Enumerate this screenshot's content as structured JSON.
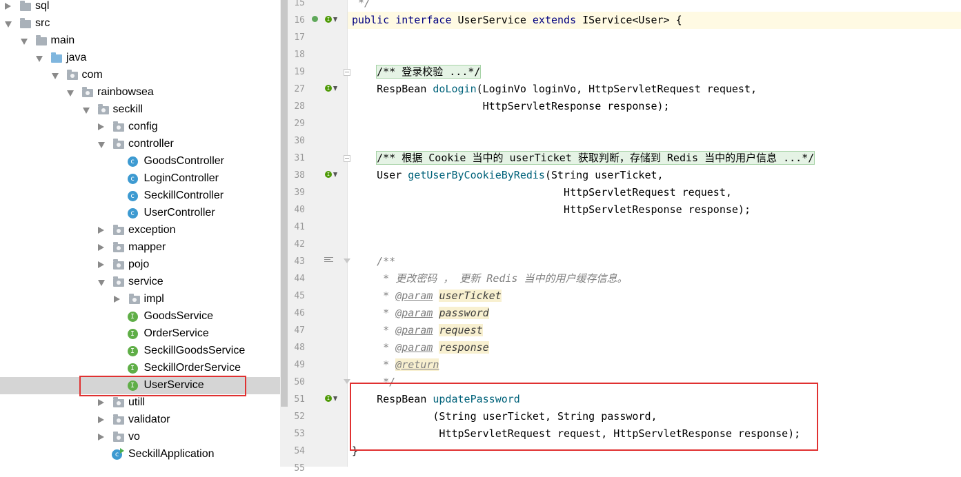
{
  "project_tree": {
    "items": [
      {
        "label": "sql",
        "depth": 0,
        "state": "collapsed",
        "icon": "folder-icon"
      },
      {
        "label": "src",
        "depth": 0,
        "state": "expanded",
        "icon": "folder-icon"
      },
      {
        "label": "main",
        "depth": 1,
        "state": "expanded",
        "icon": "folder-icon"
      },
      {
        "label": "java",
        "depth": 2,
        "state": "expanded",
        "icon": "source-folder-icon"
      },
      {
        "label": "com",
        "depth": 3,
        "state": "expanded",
        "icon": "package-icon"
      },
      {
        "label": "rainbowsea",
        "depth": 4,
        "state": "expanded",
        "icon": "package-icon"
      },
      {
        "label": "seckill",
        "depth": 5,
        "state": "expanded",
        "icon": "package-icon"
      },
      {
        "label": "config",
        "depth": 6,
        "state": "collapsed",
        "icon": "package-icon"
      },
      {
        "label": "controller",
        "depth": 6,
        "state": "expanded",
        "icon": "package-icon"
      },
      {
        "label": "GoodsController",
        "depth": 7,
        "state": "leaf",
        "icon": "class-icon"
      },
      {
        "label": "LoginController",
        "depth": 7,
        "state": "leaf",
        "icon": "class-icon"
      },
      {
        "label": "SeckillController",
        "depth": 7,
        "state": "leaf",
        "icon": "class-icon"
      },
      {
        "label": "UserController",
        "depth": 7,
        "state": "leaf",
        "icon": "class-icon"
      },
      {
        "label": "exception",
        "depth": 6,
        "state": "collapsed",
        "icon": "package-icon"
      },
      {
        "label": "mapper",
        "depth": 6,
        "state": "collapsed",
        "icon": "package-icon"
      },
      {
        "label": "pojo",
        "depth": 6,
        "state": "collapsed",
        "icon": "package-icon"
      },
      {
        "label": "service",
        "depth": 6,
        "state": "expanded",
        "icon": "package-icon"
      },
      {
        "label": "impl",
        "depth": 7,
        "state": "collapsed",
        "icon": "package-icon"
      },
      {
        "label": "GoodsService",
        "depth": 7,
        "state": "leaf",
        "icon": "interface-icon"
      },
      {
        "label": "OrderService",
        "depth": 7,
        "state": "leaf",
        "icon": "interface-icon"
      },
      {
        "label": "SeckillGoodsService",
        "depth": 7,
        "state": "leaf",
        "icon": "interface-icon"
      },
      {
        "label": "SeckillOrderService",
        "depth": 7,
        "state": "leaf",
        "icon": "interface-icon"
      },
      {
        "label": "UserService",
        "depth": 7,
        "state": "leaf",
        "icon": "interface-icon",
        "selected": true,
        "highlighted": true
      },
      {
        "label": "utill",
        "depth": 6,
        "state": "collapsed",
        "icon": "package-icon"
      },
      {
        "label": "validator",
        "depth": 6,
        "state": "collapsed",
        "icon": "package-icon"
      },
      {
        "label": "vo",
        "depth": 6,
        "state": "collapsed",
        "icon": "package-icon"
      },
      {
        "label": "SeckillApplication",
        "depth": 6,
        "state": "leaf",
        "icon": "spring-app-class-icon"
      }
    ],
    "class_badge": "c",
    "interface_badge": "I"
  },
  "editor": {
    "lines": [
      {
        "num": "15",
        "text": " */",
        "style": "comment"
      },
      {
        "num": "16",
        "text": "public interface UserService extends IService<User> {",
        "current": true,
        "gutter": "run-impl"
      },
      {
        "num": "17",
        "text": ""
      },
      {
        "num": "18",
        "text": ""
      },
      {
        "num": "19",
        "text": "    /** 登录校验 ...*/",
        "style": "folded",
        "fold": "box"
      },
      {
        "num": "27",
        "text": "    RespBean doLogin(LoginVo loginVo, HttpServletRequest request,",
        "gutter": "impl",
        "method": "doLogin"
      },
      {
        "num": "28",
        "text": "                     HttpServletResponse response);"
      },
      {
        "num": "29",
        "text": ""
      },
      {
        "num": "30",
        "text": ""
      },
      {
        "num": "31",
        "text": "    /** 根据 Cookie 当中的 userTicket 获取判断，存储到 Redis 当中的用户信息 ...*/",
        "style": "folded",
        "fold": "box"
      },
      {
        "num": "38",
        "text": "    User getUserByCookieByRedis(String userTicket,",
        "gutter": "impl",
        "method": "getUserByCookieByRedis"
      },
      {
        "num": "39",
        "text": "                                  HttpServletRequest request,"
      },
      {
        "num": "40",
        "text": "                                  HttpServletResponse response);"
      },
      {
        "num": "41",
        "text": ""
      },
      {
        "num": "42",
        "text": ""
      },
      {
        "num": "43",
        "text": "    /**",
        "style": "comment",
        "fold": "end",
        "gutter": "doc"
      },
      {
        "num": "44",
        "text": "     * 更改密码 ， 更新 Redis 当中的用户缓存信息。",
        "style": "comment"
      },
      {
        "num": "45",
        "text": "     * @param userTicket",
        "style": "javadoc-param",
        "tag": "@param",
        "param": "userTicket"
      },
      {
        "num": "46",
        "text": "     * @param password",
        "style": "javadoc-param",
        "tag": "@param",
        "param": "password"
      },
      {
        "num": "47",
        "text": "     * @param request",
        "style": "javadoc-param",
        "tag": "@param",
        "param": "request"
      },
      {
        "num": "48",
        "text": "     * @param response",
        "style": "javadoc-param",
        "tag": "@param",
        "param": "response"
      },
      {
        "num": "49",
        "text": "     * @return",
        "style": "javadoc-return",
        "tag": "@return"
      },
      {
        "num": "50",
        "text": "     */",
        "style": "comment",
        "fold": "end"
      },
      {
        "num": "51",
        "text": "    RespBean updatePassword",
        "gutter": "impl",
        "method": "updatePassword"
      },
      {
        "num": "52",
        "text": "             (String userTicket, String password,"
      },
      {
        "num": "53",
        "text": "              HttpServletRequest request, HttpServletResponse response);"
      },
      {
        "num": "54",
        "text": "}"
      },
      {
        "num": "55",
        "text": ""
      }
    ],
    "impl_badge": "I"
  },
  "colors": {
    "keyword": "#000080",
    "method": "#00627a",
    "comment": "#808080",
    "highlight_box": "#e03131",
    "selected_row": "#d5d5d5"
  }
}
